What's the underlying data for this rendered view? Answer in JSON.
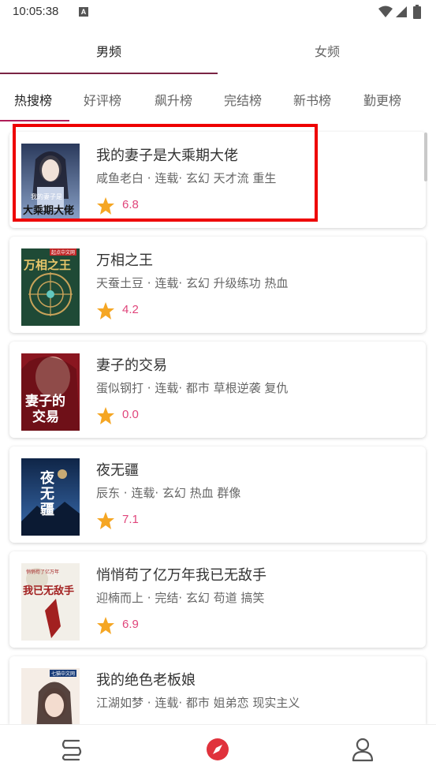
{
  "status_bar": {
    "time": "10:05:38",
    "notif_letter": "A"
  },
  "gender_tabs": [
    {
      "label": "男频",
      "active": true
    },
    {
      "label": "女频",
      "active": false
    }
  ],
  "rank_tabs": [
    {
      "label": "热搜榜",
      "active": true
    },
    {
      "label": "好评榜"
    },
    {
      "label": "飙升榜"
    },
    {
      "label": "完结榜"
    },
    {
      "label": "新书榜"
    },
    {
      "label": "勤更榜"
    }
  ],
  "books": [
    {
      "title": "我的妻子是大乘期大佬",
      "author": "咸鱼老白",
      "status": "连载",
      "tags": "玄幻 天才流 重生",
      "score": "6.8"
    },
    {
      "title": "万相之王",
      "author": "天蚕土豆",
      "status": "连载",
      "tags": "玄幻 升级练功 热血",
      "score": "4.2"
    },
    {
      "title": "妻子的交易",
      "author": "蛋似钢打",
      "status": "连载",
      "tags": "都市 草根逆袭 复仇",
      "score": "0.0"
    },
    {
      "title": "夜无疆",
      "author": "辰东",
      "status": "连载",
      "tags": "玄幻 热血 群像",
      "score": "7.1"
    },
    {
      "title": "悄悄苟了亿万年我已无敌手",
      "author": "迎楠而上",
      "status": "完结",
      "tags": "玄幻 苟道 搞笑",
      "score": "6.9"
    },
    {
      "title": "我的绝色老板娘",
      "author": "江湖如梦",
      "status": "连载",
      "tags": "都市 姐弟恋 现实主义",
      "score": ""
    }
  ],
  "cover_text": {
    "b1": "大乘期大佬",
    "b1_top": "我的妻子是",
    "b2": "万相之王",
    "b2_top": "起点中文网",
    "b3_a": "妻子的",
    "b3_b": "交易",
    "b4": "夜无疆",
    "b5_main": "我已无敌手",
    "b5_top": "悄悄苟了亿万年",
    "b6_top": "七猫中文网"
  },
  "meta_sep": " · ",
  "meta_sep2": "· ",
  "bottom_nav": [
    {
      "icon": "bookshelf-icon"
    },
    {
      "icon": "compass-icon",
      "active": true
    },
    {
      "icon": "profile-icon"
    }
  ],
  "colors": {
    "accent": "#b01e58",
    "score": "#e0457b",
    "star": "#f5a623",
    "highlight": "#ee0000"
  }
}
